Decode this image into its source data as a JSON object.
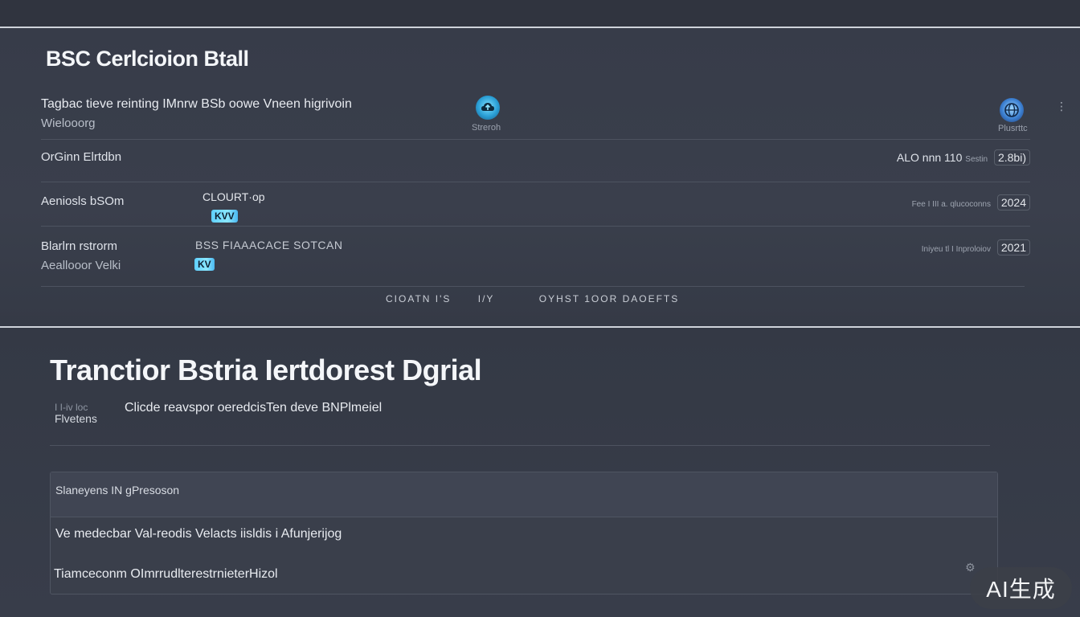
{
  "panel1": {
    "title": "BSC Cerlcioion Btall",
    "header_line1": "Tagbac tieve reinting IMnrw BSb oowe Vneen higrivoin",
    "header_line2": "Wielooorg",
    "icon_a": {
      "icon": "cloud-upload-icon",
      "caption": "Streroh"
    },
    "icon_b": {
      "icon": "globe-icon",
      "caption": "Plusrttc"
    },
    "kebab": "⋮",
    "rows": [
      {
        "label": "OrGinn Elrtdbn",
        "right_text": "ALO nnn 110",
        "right_small": "Sestin",
        "right_date": "2.8bi)"
      },
      {
        "label": "Aeniosls bSOm",
        "middle": "CLOURT·op",
        "pill": "KVV",
        "right_text": "Fee I III a. qlucoconns",
        "right_date": "2024"
      },
      {
        "label": "Blarlrn rstrorm",
        "sublabel": "Aeallooor Velki",
        "middle": "BSS FIAAACACE SOTCAN",
        "pill": "KV",
        "right_text": "Iniyeu tl I Inproloiov",
        "right_date": "2021"
      }
    ],
    "footer_links": [
      "CIOATN I'S",
      "I/Y",
      "OYHST 1OOR DAOEFTS"
    ]
  },
  "panel2": {
    "title": "Tranctior Bstria Iertdorest Dgrial",
    "desc_prefix_top": "I I-iv loc",
    "desc_prefix_bottom": "Flvetens",
    "description": "Clicde reavspor oeredcisTen deve BNPlmeiel",
    "table": {
      "header": "Slaneyens IN gPresoson",
      "rows": [
        "Ve medecbar Val-reodis Velacts iisldis i Afunjerijog",
        "Tiamceconm OImrrudlterestrnieterHizol"
      ]
    }
  },
  "watermark": "AI生成"
}
